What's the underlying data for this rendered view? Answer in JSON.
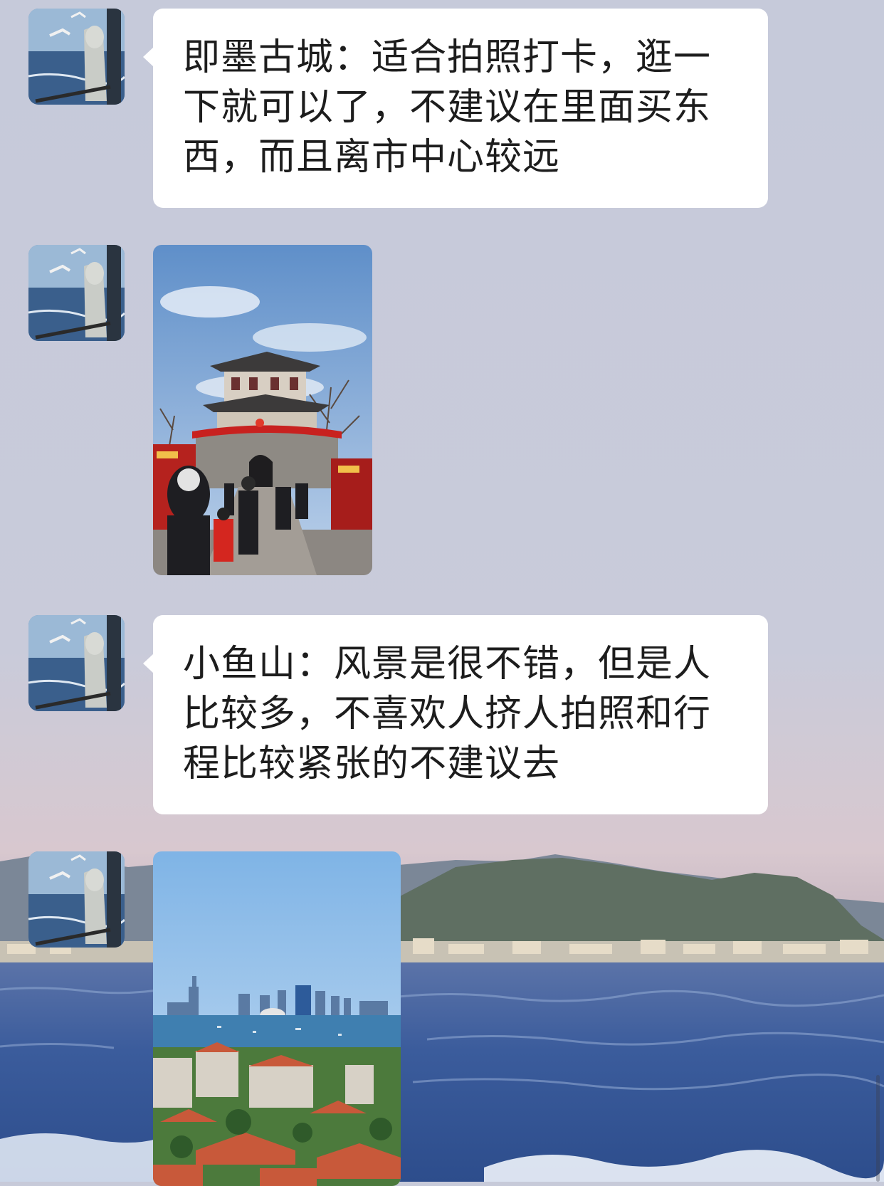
{
  "chat": {
    "messages": [
      {
        "type": "text",
        "sender_avatar_icon": "user-avatar-icon",
        "text": "即墨古城：适合拍照打卡，逛一下就可以了，不建议在里面买东西，而且离市中心较远"
      },
      {
        "type": "image",
        "sender_avatar_icon": "user-avatar-icon",
        "image_content": "photo-icon"
      },
      {
        "type": "text",
        "sender_avatar_icon": "user-avatar-icon",
        "text": "小鱼山：风景是很不错，但是人比较多，不喜欢人挤人拍照和行程比较紧张的不建议去"
      },
      {
        "type": "image",
        "sender_avatar_icon": "user-avatar-icon",
        "image_content": "photo-icon"
      }
    ]
  },
  "colors": {
    "background_top": "#c7cad9",
    "bubble": "#ffffff",
    "text": "#1d1d1d",
    "sea": "#3b5c9c"
  }
}
